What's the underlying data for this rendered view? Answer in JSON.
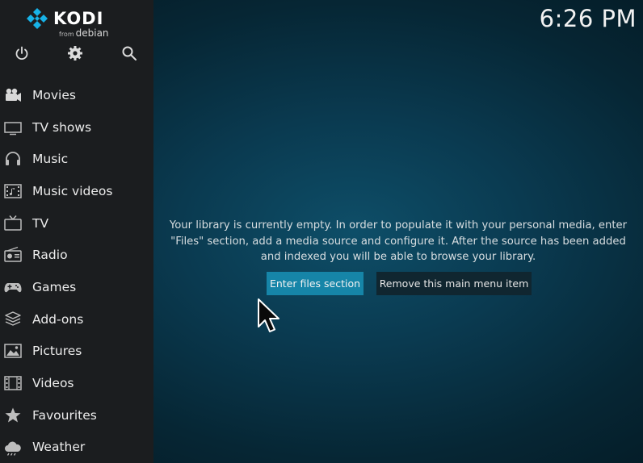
{
  "app": {
    "logo_text": "KODI",
    "logo_sub_small": "from",
    "logo_sub": "debian"
  },
  "clock": "6:26 PM",
  "top_icons": [
    "power-icon",
    "gear-icon",
    "search-icon"
  ],
  "menu": {
    "items": [
      {
        "label": "Movies",
        "icon": "movie-camera-icon"
      },
      {
        "label": "TV shows",
        "icon": "tv-monitor-icon"
      },
      {
        "label": "Music",
        "icon": "headphones-icon"
      },
      {
        "label": "Music videos",
        "icon": "film-strip-icon"
      },
      {
        "label": "TV",
        "icon": "tv-icon"
      },
      {
        "label": "Radio",
        "icon": "radio-icon"
      },
      {
        "label": "Games",
        "icon": "gamepad-icon"
      },
      {
        "label": "Add-ons",
        "icon": "box-icon"
      },
      {
        "label": "Pictures",
        "icon": "picture-icon"
      },
      {
        "label": "Videos",
        "icon": "film-icon"
      },
      {
        "label": "Favourites",
        "icon": "star-icon"
      },
      {
        "label": "Weather",
        "icon": "weather-cloud-icon"
      }
    ]
  },
  "main": {
    "message": "Your library is currently empty. In order to populate it with your personal media, enter \"Files\" section, add a media source and configure it. After the source has been added and indexed you will be able to browse your library.",
    "primary_button": "Enter files section",
    "secondary_button": "Remove this main menu item"
  },
  "colors": {
    "accent": "#1685a8",
    "sidebar": "#1b1d1f",
    "logo_blue": "#17b2e7"
  }
}
